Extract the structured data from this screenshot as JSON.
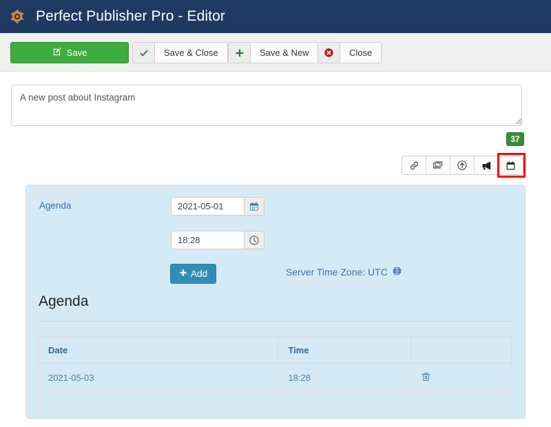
{
  "window": {
    "cog_icon": "cog-icon",
    "title": "Perfect Publisher Pro - Editor",
    "header_bg": "#1e3a63",
    "cog_color": "#e08a28"
  },
  "toolbar": {
    "save": {
      "label": "Save",
      "icon": "edit-square-icon",
      "color": "#3eac3e"
    },
    "save_close": {
      "label": "Save & Close",
      "icon": "check-icon",
      "icon_color": "#2c7a2c"
    },
    "save_new": {
      "label": "Save & New",
      "icon": "plus-icon",
      "icon_color": "#2c7a2c"
    },
    "close": {
      "label": "Close",
      "icon": "times-circle-icon",
      "icon_color": "#b02020"
    }
  },
  "editor": {
    "post_text": "A new post about Instagram",
    "post_placeholder": "",
    "char_count": "37",
    "char_count_color": "#3a8c3a",
    "icons": [
      {
        "name": "link-icon",
        "label": "Insert link"
      },
      {
        "name": "images-icon",
        "label": "Insert image"
      },
      {
        "name": "upload-circle-icon",
        "label": "Upload"
      },
      {
        "name": "bullhorn-icon",
        "label": "Promote"
      },
      {
        "name": "calendar-icon",
        "label": "Schedule",
        "highlighted": true
      }
    ],
    "highlight_color": "#ff0000"
  },
  "agenda": {
    "panel_bg": "#d6eaf5",
    "label": "Agenda",
    "date_value": "2021-05-01",
    "date_icon": "calendar-icon",
    "time_value": "18:28",
    "time_icon": "clock-icon",
    "add_button": {
      "label": "Add",
      "icon": "plus-icon",
      "color": "#2e8eb8"
    },
    "timezone_text": "Server Time Zone: UTC",
    "timezone_icon": "globe-icon",
    "heading": "Agenda",
    "table": {
      "columns": [
        "Date",
        "Time",
        ""
      ],
      "rows": [
        {
          "date": "2021-05-03",
          "time": "18:28",
          "action_icon": "trash-icon"
        }
      ]
    }
  }
}
